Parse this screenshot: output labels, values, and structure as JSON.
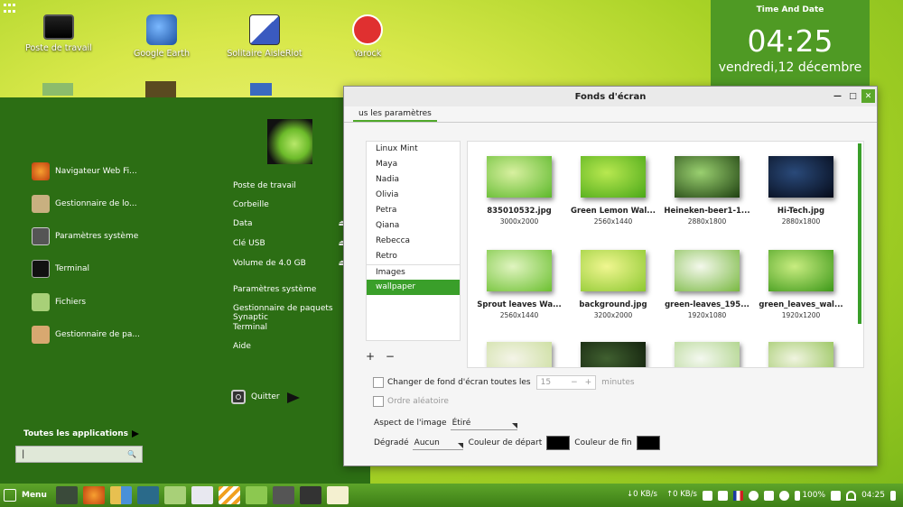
{
  "desktop": {
    "icons": [
      {
        "label": "Poste de travail"
      },
      {
        "label": "Google Earth"
      },
      {
        "label": "Solitaire AisleRiot"
      },
      {
        "label": "Yarock"
      }
    ]
  },
  "clock_widget": {
    "title": "Time And Date",
    "time": "04:25",
    "date": "vendredi,12 décembre"
  },
  "app_menu": {
    "favorites": [
      {
        "label": "Navigateur Web Fi..."
      },
      {
        "label": "Gestionnaire de lo..."
      },
      {
        "label": "Paramètres système"
      },
      {
        "label": "Terminal"
      },
      {
        "label": "Fichiers"
      },
      {
        "label": "Gestionnaire de pa..."
      }
    ],
    "places": [
      {
        "label": "Poste de travail",
        "eject": ""
      },
      {
        "label": "Corbeille",
        "eject": ""
      },
      {
        "label": "Data",
        "eject": "⏏"
      },
      {
        "label": "Clé USB",
        "eject": "⏏"
      },
      {
        "label": "Volume de 4.0 GB",
        "eject": "⏏"
      }
    ],
    "system": [
      {
        "label": "Paramètres système"
      },
      {
        "label": "Gestionnaire de paquets Synaptic"
      },
      {
        "label": "Terminal"
      },
      {
        "label": "Aide"
      }
    ],
    "quit_label": "Quitter",
    "all_apps_label": "Toutes les applications",
    "search_value": "|",
    "search_icon": "🔍"
  },
  "window": {
    "title": "Fonds d'écran",
    "tab_label": "us les paramètres",
    "buttons": {
      "min": "—",
      "max": "□",
      "close": "✕"
    },
    "themes": [
      "Linux Mint",
      "Maya",
      "Nadia",
      "Olivia",
      "Petra",
      "Qiana",
      "Rebecca",
      "Retro"
    ],
    "folders": [
      "Images",
      "wallpaper"
    ],
    "selected_folder": "wallpaper",
    "add_label": "+",
    "remove_label": "−",
    "wallpapers": [
      {
        "name": "835010532.jpg",
        "dims": "3000x2000",
        "c1": "#d8f0a0",
        "c2": "#5cb82a"
      },
      {
        "name": "Green Lemon Wal...",
        "dims": "2560x1440",
        "c1": "#b8e850",
        "c2": "#4aa818"
      },
      {
        "name": "Heineken-beer1-1...",
        "dims": "2880x1800",
        "c1": "#9ad070",
        "c2": "#1e4010"
      },
      {
        "name": "Hi-Tech.jpg",
        "dims": "2880x1800",
        "c1": "#2a4a7a",
        "c2": "#050a18"
      },
      {
        "name": "Sprout leaves Wa...",
        "dims": "2560x1440",
        "c1": "#e0f4c0",
        "c2": "#6cc030"
      },
      {
        "name": "background.jpg",
        "dims": "3200x2000",
        "c1": "#f0f690",
        "c2": "#8cc830"
      },
      {
        "name": "green-leaves_195...",
        "dims": "1920x1080",
        "c1": "#f4f8ec",
        "c2": "#78b840"
      },
      {
        "name": "green_leaves_wal...",
        "dims": "1920x1200",
        "c1": "#c8ec80",
        "c2": "#3c9818"
      },
      {
        "name": "",
        "dims": "",
        "c1": "#f4f4e8",
        "c2": "#c8dc98"
      },
      {
        "name": "",
        "dims": "",
        "c1": "#406030",
        "c2": "#0c1808"
      },
      {
        "name": "",
        "dims": "",
        "c1": "#f4f8f0",
        "c2": "#a8d080"
      },
      {
        "name": "",
        "dims": "",
        "c1": "#f0f4e0",
        "c2": "#90c050"
      }
    ],
    "options": {
      "change_label": "Changer de fond d'écran toutes les",
      "interval": "15",
      "minus": "−",
      "plus": "+",
      "minutes_label": "minutes",
      "random_label": "Ordre aléatoire",
      "aspect_label": "Aspect de l'image",
      "aspect_value": "Étiré",
      "gradient_label": "Dégradé",
      "gradient_value": "Aucun",
      "start_color_label": "Couleur de départ",
      "end_color_label": "Couleur de fin"
    }
  },
  "taskbar": {
    "menu_label": "Menu",
    "net_down": "↓0 KB/s",
    "net_up": "↑0 KB/s",
    "battery": "100%",
    "time": "04:25"
  },
  "colors": {
    "accent": "#3a9f2a",
    "menu_bg": "#2c6e14",
    "clock_bg": "#4f9a24"
  }
}
